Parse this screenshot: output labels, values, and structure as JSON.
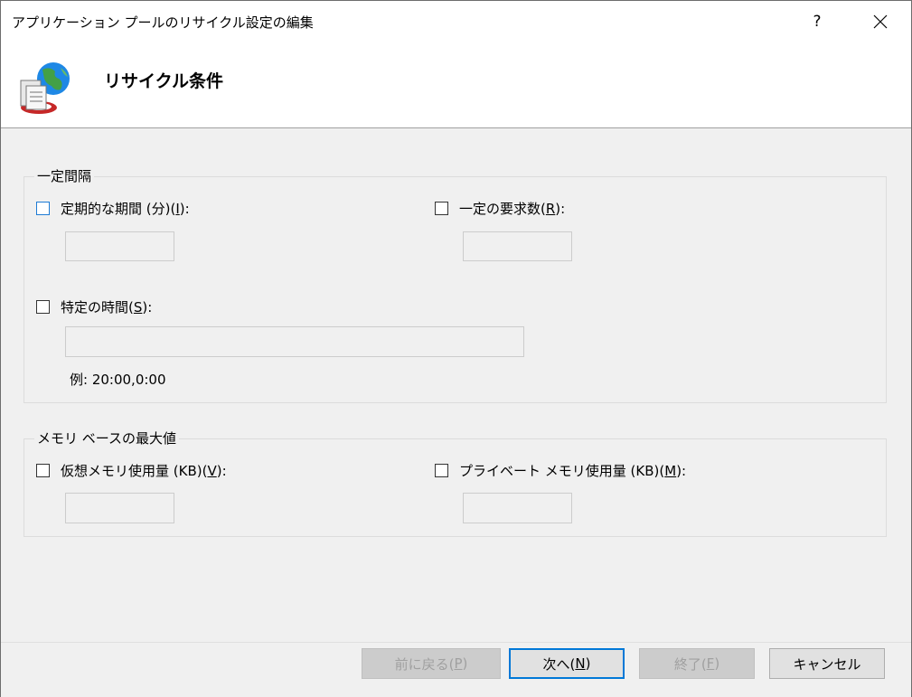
{
  "window": {
    "title": "アプリケーション プールのリサイクル設定の編集",
    "help_label": "?",
    "close_icon": "close-icon"
  },
  "header": {
    "icon": "recycle-globe-icon",
    "title": "リサイクル条件"
  },
  "fixed_interval": {
    "group_label": "一定間隔",
    "regular_time": {
      "label_pre": "定期的な期間 (分)(",
      "accel": "I",
      "label_post": "):",
      "checked": false,
      "value": ""
    },
    "request_limit": {
      "label_pre": "一定の要求数(",
      "accel": "R",
      "label_post": "):",
      "checked": false,
      "value": ""
    },
    "specific_times": {
      "label_pre": "特定の時間(",
      "accel": "S",
      "label_post": "):",
      "checked": false,
      "value": "",
      "example": "例: 20:00,0:00"
    }
  },
  "memory": {
    "group_label": "メモリ ベースの最大値",
    "virtual": {
      "label_pre": "仮想メモリ使用量 (KB)(",
      "accel": "V",
      "label_post": "):",
      "checked": false,
      "value": ""
    },
    "private": {
      "label_pre": "プライベート メモリ使用量 (KB)(",
      "accel": "M",
      "label_post": "):",
      "checked": false,
      "value": ""
    }
  },
  "buttons": {
    "prev": {
      "pre": "前に戻る(",
      "accel": "P",
      "post": ")"
    },
    "next": {
      "pre": "次へ(",
      "accel": "N",
      "post": ")"
    },
    "finish": {
      "pre": "終了(",
      "accel": "F",
      "post": ")"
    },
    "cancel": "キャンセル"
  }
}
